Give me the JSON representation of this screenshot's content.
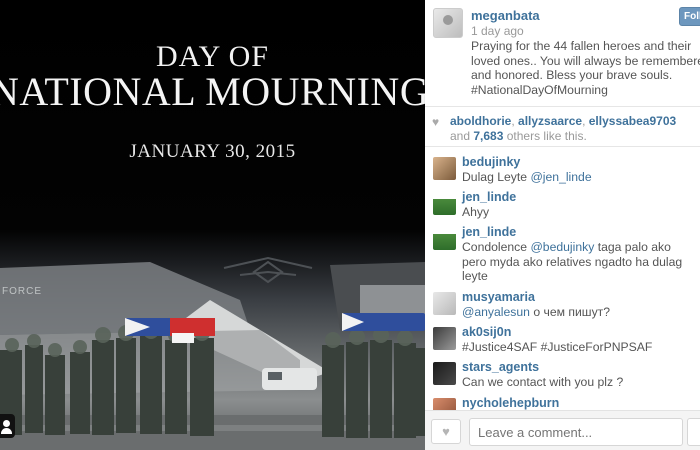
{
  "photo": {
    "title_line1": "Day of",
    "title_line2": "National Mourning",
    "date": "January 30, 2015",
    "plane_text": "FORCE"
  },
  "post": {
    "owner": "meganbata",
    "follow_label": "Follow",
    "time": "1 day ago",
    "caption": "Praying for the 44 fallen heroes and their loved ones.. You will always be remembered and honored. Bless your brave souls. #NationalDayOfMourning"
  },
  "likes": {
    "liker1": "aboldhorie",
    "liker2": "allyzsaarce",
    "liker3": "ellyssabea9703",
    "and_label": "and",
    "others_count": "7,683",
    "others_suffix": "others like this."
  },
  "comments": [
    {
      "user": "bedujinky",
      "text": "Dulag Leyte ",
      "mention": "@jen_linde",
      "text_after": ""
    },
    {
      "user": "jen_linde",
      "text": "Ahyy",
      "mention": "",
      "text_after": ""
    },
    {
      "user": "jen_linde",
      "text": "Condolence ",
      "mention": "@bedujinky",
      "text_after": " taga palo ako pero myda ako relatives ngadto ha dulag leyte"
    },
    {
      "user": "musyamaria",
      "text": "",
      "mention": "@anyalesun",
      "text_after": " о чем пишут?"
    },
    {
      "user": "ak0sij0n",
      "text": "#Justice4SAF #JusticeForPNPSAF",
      "mention": "",
      "text_after": ""
    },
    {
      "user": "stars_agents",
      "text": "Can we contact with you plz ?",
      "mention": "",
      "text_after": ""
    },
    {
      "user": "nycholehepburn",
      "text": "",
      "mention": "",
      "text_after": ""
    }
  ],
  "footer": {
    "comment_placeholder": "Leave a comment..."
  }
}
